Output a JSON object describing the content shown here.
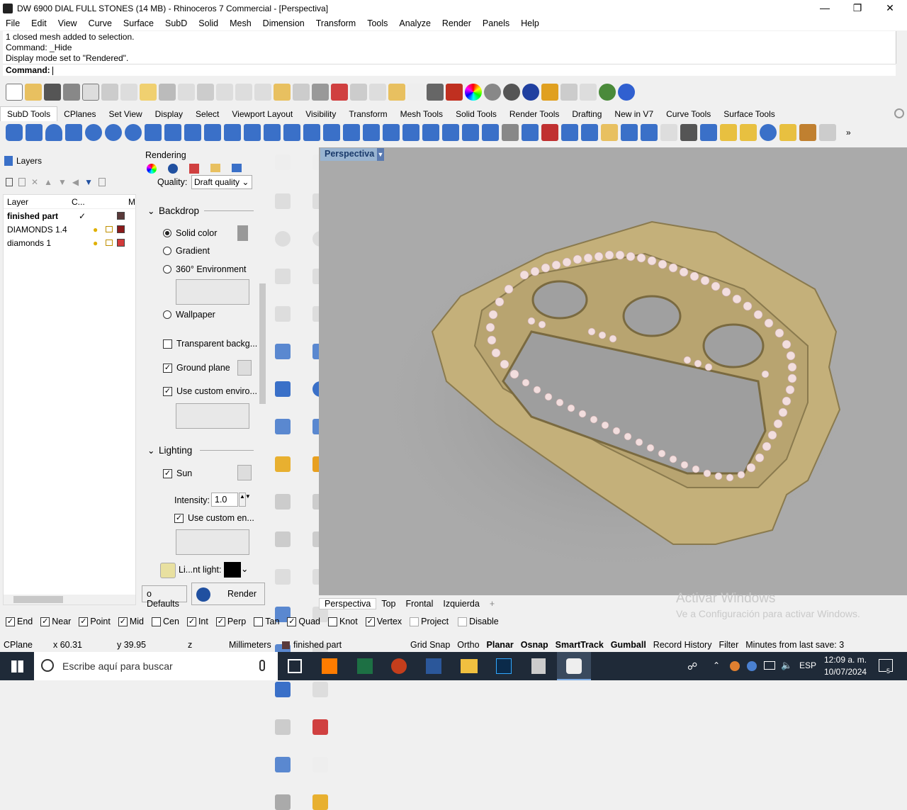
{
  "window": {
    "title": "DW 6900 DIAL FULL STONES (14 MB) - Rhinoceros 7 Commercial - [Perspectiva]",
    "min": "—",
    "max": "❐",
    "close": "✕"
  },
  "menu": [
    "File",
    "Edit",
    "View",
    "Curve",
    "Surface",
    "SubD",
    "Solid",
    "Mesh",
    "Dimension",
    "Transform",
    "Tools",
    "Analyze",
    "Render",
    "Panels",
    "Help"
  ],
  "command": {
    "history": [
      "1 closed mesh added to selection.",
      "Command: _Hide",
      "Display mode set to \"Rendered\"."
    ],
    "prompt": "Command:"
  },
  "toolbar_tabs": [
    "SubD Tools",
    "CPlanes",
    "Set View",
    "Display",
    "Select",
    "Viewport Layout",
    "Visibility",
    "Transform",
    "Mesh Tools",
    "Solid Tools",
    "Render Tools",
    "Drafting",
    "New in V7",
    "Curve Tools",
    "Surface Tools"
  ],
  "layers": {
    "panel_title": "Layers",
    "col_layer": "Layer",
    "col_c": "C...",
    "col_m": "M",
    "rows": [
      {
        "name": "finished part",
        "current": "✓",
        "color": "#5a3a3a"
      },
      {
        "name": "DIAMONDS 1.4",
        "color": "#8b1a1a"
      },
      {
        "name": "diamonds 1",
        "color": "#d23a3a"
      }
    ]
  },
  "rendering": {
    "panel_title": "Rendering",
    "quality_label": "Quality:",
    "quality_value": "Draft quality",
    "backdrop": "Backdrop",
    "solid_color": "Solid color",
    "gradient": "Gradient",
    "env360": "360° Environment",
    "wallpaper": "Wallpaper",
    "transparent": "Transparent backg...",
    "ground_plane": "Ground plane",
    "use_custom_env": "Use custom enviro...",
    "lighting": "Lighting",
    "sun": "Sun",
    "intensity_label": "Intensity:",
    "intensity_value": "1.0",
    "use_custom_en": "Use custom en...",
    "light_label": "Li...nt light:",
    "defaults": "o Defaults",
    "render": "Render"
  },
  "viewport": {
    "name": "Perspectiva",
    "tabs": [
      "Perspectiva",
      "Top",
      "Frontal",
      "Izquierda"
    ],
    "add": "+"
  },
  "watermark": {
    "line1": "Activar Windows",
    "line2": "Ve a Configuración para activar Windows."
  },
  "osnap": [
    {
      "label": "End",
      "on": true
    },
    {
      "label": "Near",
      "on": true
    },
    {
      "label": "Point",
      "on": true
    },
    {
      "label": "Mid",
      "on": true
    },
    {
      "label": "Cen",
      "on": false
    },
    {
      "label": "Int",
      "on": true
    },
    {
      "label": "Perp",
      "on": true
    },
    {
      "label": "Tan",
      "on": false
    },
    {
      "label": "Quad",
      "on": true
    },
    {
      "label": "Knot",
      "on": false
    },
    {
      "label": "Vertex",
      "on": true
    },
    {
      "label": "Project",
      "on": false
    },
    {
      "label": "Disable",
      "on": false
    }
  ],
  "status": {
    "cplane": "CPlane",
    "x": "x 60.31",
    "y": "y 39.95",
    "z": "z",
    "units": "Millimeters",
    "layer": "finished part",
    "grid_snap": "Grid Snap",
    "ortho": "Ortho",
    "planar": "Planar",
    "osnap": "Osnap",
    "smarttrack": "SmartTrack",
    "gumball": "Gumball",
    "record_history": "Record History",
    "filter": "Filter",
    "minutes": "Minutes from last save: 3"
  },
  "taskbar": {
    "search": "Escribe aquí para buscar",
    "lang": "ESP",
    "time": "12:09 a. m.",
    "date": "10/07/2024",
    "notif": "5"
  }
}
